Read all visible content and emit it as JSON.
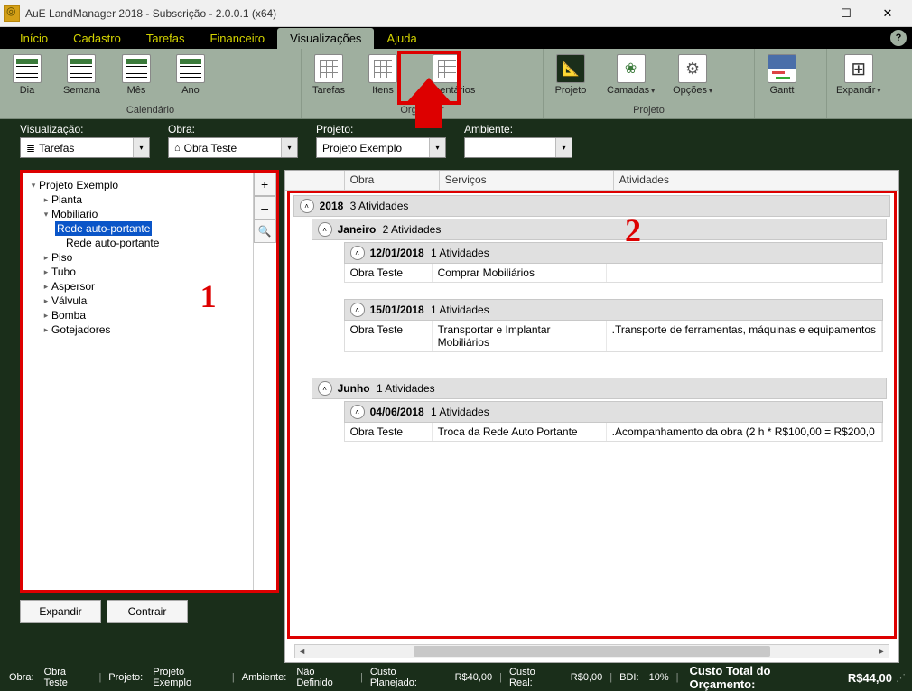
{
  "window": {
    "title": "AuE LandManager 2018  - Subscrição - 2.0.0.1 (x64)"
  },
  "menubar": {
    "items": [
      "Início",
      "Cadastro",
      "Tarefas",
      "Financeiro",
      "Visualizações",
      "Ajuda"
    ],
    "active_index": 4
  },
  "ribbon": {
    "groups": [
      {
        "label": "Calendário",
        "buttons": [
          "Dia",
          "Semana",
          "Mês",
          "Ano"
        ]
      },
      {
        "label": "Organizar",
        "buttons": [
          "Tarefas",
          "Itens",
          "Comentários"
        ]
      },
      {
        "label": "Projeto",
        "buttons": [
          "Projeto",
          "Camadas",
          "Opções"
        ]
      },
      {
        "label": "",
        "buttons": [
          "Gantt"
        ]
      },
      {
        "label": "",
        "buttons": [
          "Expandir"
        ]
      }
    ]
  },
  "filters": {
    "visualizacao": {
      "label": "Visualização:",
      "value": "Tarefas"
    },
    "obra": {
      "label": "Obra:",
      "value": "Obra Teste"
    },
    "projeto": {
      "label": "Projeto:",
      "value": "Projeto Exemplo"
    },
    "ambiente": {
      "label": "Ambiente:",
      "value": ""
    }
  },
  "tree": {
    "root": "Projeto Exemplo",
    "items": [
      {
        "label": "Planta",
        "depth": 1,
        "expandable": true
      },
      {
        "label": "Mobiliario",
        "depth": 1,
        "expanded": true
      },
      {
        "label": "Rede auto-portante",
        "depth": 2,
        "selected": true
      },
      {
        "label": "Rede auto-portante",
        "depth": 2
      },
      {
        "label": "Piso",
        "depth": 1,
        "expandable": true
      },
      {
        "label": "Tubo",
        "depth": 1,
        "expandable": true
      },
      {
        "label": "Aspersor",
        "depth": 1,
        "expandable": true
      },
      {
        "label": "Válvula",
        "depth": 1,
        "expandable": true
      },
      {
        "label": "Bomba",
        "depth": 1,
        "expandable": true
      },
      {
        "label": "Gotejadores",
        "depth": 1,
        "expandable": true
      }
    ],
    "buttons": {
      "expand": "Expandir",
      "contract": "Contrair"
    },
    "annotation": "1"
  },
  "columns": {
    "c1": "Obra",
    "c2": "Serviços",
    "c3": "Atividades"
  },
  "activities": {
    "annotation": "2",
    "year": {
      "title": "2018",
      "sub": "3 Atividades"
    },
    "months": [
      {
        "title": "Janeiro",
        "sub": "2 Atividades",
        "days": [
          {
            "title": "12/01/2018",
            "sub": "1 Atividades",
            "rows": [
              {
                "obra": "Obra Teste",
                "servico": "Comprar Mobiliários",
                "ativ": ""
              }
            ]
          },
          {
            "title": "15/01/2018",
            "sub": "1 Atividades",
            "rows": [
              {
                "obra": "Obra Teste",
                "servico": "Transportar e Implantar Mobiliários",
                "ativ": ".Transporte de ferramentas, máquinas e equipamentos"
              }
            ]
          }
        ]
      },
      {
        "title": "Junho",
        "sub": "1 Atividades",
        "days": [
          {
            "title": "04/06/2018",
            "sub": "1 Atividades",
            "rows": [
              {
                "obra": "Obra Teste",
                "servico": "Troca da Rede Auto Portante",
                "ativ": ".Acompanhamento da obra (2 h * R$100,00 = R$200,0"
              }
            ]
          }
        ]
      }
    ]
  },
  "status": {
    "obra_l": "Obra:",
    "obra_v": "Obra Teste",
    "proj_l": "Projeto:",
    "proj_v": "Projeto Exemplo",
    "amb_l": "Ambiente:",
    "amb_v": "Não Definido",
    "cplan_l": "Custo Planejado:",
    "cplan_v": "R$40,00",
    "creal_l": "Custo Real:",
    "creal_v": "R$0,00",
    "bdi_l": "BDI:",
    "bdi_v": "10%",
    "tot_l": "Custo Total do Orçamento:",
    "tot_v": "R$44,00"
  }
}
